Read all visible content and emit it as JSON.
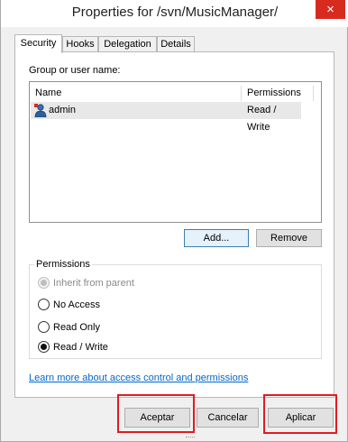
{
  "window": {
    "title": "Properties for /svn/MusicManager/",
    "close_glyph": "×"
  },
  "tabs": [
    {
      "label": "Security",
      "active": true
    },
    {
      "label": "Hooks",
      "active": false
    },
    {
      "label": "Delegation",
      "active": false
    },
    {
      "label": "Details",
      "active": false
    }
  ],
  "security": {
    "group_label": "Group or user name:",
    "columns": [
      "Name",
      "Permissions"
    ],
    "rows": [
      {
        "name": "admin",
        "permission": "Read / Write",
        "icon": "user-icon"
      }
    ],
    "add_button": "Add...",
    "remove_button": "Remove",
    "permissions_group": {
      "title": "Permissions",
      "options": [
        {
          "label": "Inherit from parent",
          "checked": true,
          "disabled": true
        },
        {
          "label": "No Access",
          "checked": false,
          "disabled": false
        },
        {
          "label": "Read Only",
          "checked": false,
          "disabled": false
        },
        {
          "label": "Read / Write",
          "checked": true,
          "disabled": false
        }
      ]
    },
    "help_link": "Learn more about access control and permissions"
  },
  "buttons": {
    "accept": "Aceptar",
    "cancel": "Cancelar",
    "apply": "Aplicar"
  },
  "colors": {
    "close_red": "#d72b20",
    "highlight_red": "#e01b24",
    "link_blue": "#0066cc"
  }
}
